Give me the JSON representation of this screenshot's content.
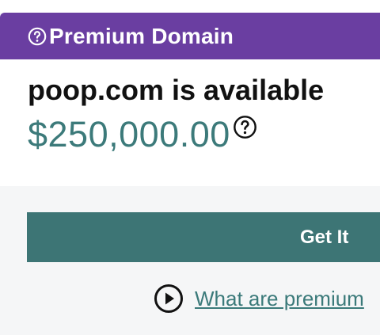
{
  "banner": {
    "icon": "question-circle-icon",
    "title": "Premium Domain",
    "color": "#6a3ea1"
  },
  "domain": {
    "availability_text": "poop.com is available",
    "price": "$250,000.00",
    "price_help_icon": "question-circle-icon",
    "price_color": "#3c7a7a"
  },
  "actions": {
    "get_it_label": "Get It",
    "button_color": "#3d7575",
    "info_icon": "play-circle-icon",
    "info_link_text": "What are premium"
  }
}
